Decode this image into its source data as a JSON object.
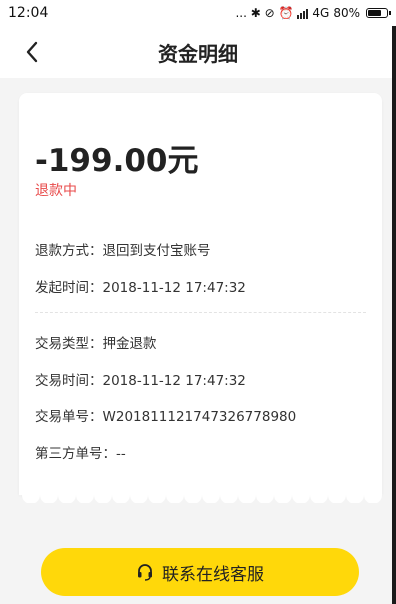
{
  "status_bar": {
    "time": "12:04",
    "icons_text": "... ✱ ⊘ ⏰",
    "network": "4G",
    "battery": "80%",
    "battery_level": 0.8
  },
  "nav": {
    "back_icon": "back-chevron-icon",
    "title": "资金明细"
  },
  "card": {
    "amount": "-199.00元",
    "status": "退款中",
    "status_color": "#e84a4a",
    "rows": [
      {
        "label": "退款方式",
        "value": "退回到支付宝账号"
      },
      {
        "label": "发起时间",
        "value": "2018-11-12 17:47:32"
      },
      {
        "label": "交易类型",
        "value": "押金退款"
      },
      {
        "label": "交易时间",
        "value": "2018-11-12 17:47:32"
      },
      {
        "label": "交易单号",
        "value": "W2018111217473267789​80"
      },
      {
        "label": "第三方单号",
        "value": "--"
      }
    ]
  },
  "contact_button": {
    "icon": "headset-icon",
    "label": "联系在线客服",
    "color": "#ffd80a"
  }
}
